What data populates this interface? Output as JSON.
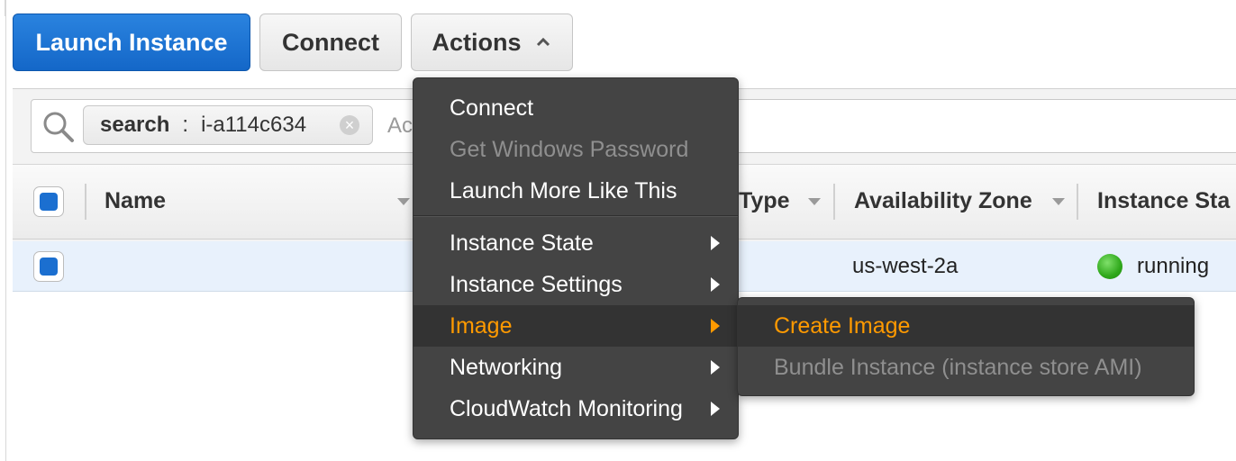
{
  "toolbar": {
    "launch_label": "Launch Instance",
    "connect_label": "Connect",
    "actions_label": "Actions"
  },
  "search": {
    "token_key": "search",
    "token_sep": ":",
    "token_value": "i-a114c634",
    "placeholder_fragment": "Ac"
  },
  "table": {
    "columns": [
      "Name",
      "Type",
      "Availability Zone",
      "Instance Sta"
    ],
    "row": {
      "name": "",
      "availability_zone": "us-west-2a",
      "instance_state": "running"
    }
  },
  "actions_menu": {
    "items": [
      {
        "label": "Connect",
        "enabled": true
      },
      {
        "label": "Get Windows Password",
        "enabled": false
      },
      {
        "label": "Launch More Like This",
        "enabled": true
      },
      {
        "label": "Instance State",
        "submenu": true
      },
      {
        "label": "Instance Settings",
        "submenu": true
      },
      {
        "label": "Image",
        "submenu": true,
        "active": true
      },
      {
        "label": "Networking",
        "submenu": true
      },
      {
        "label": "CloudWatch Monitoring",
        "submenu": true
      }
    ]
  },
  "image_submenu": {
    "items": [
      {
        "label": "Create Image",
        "active": true
      },
      {
        "label": "Bundle Instance (instance store AMI)",
        "enabled": false
      }
    ]
  },
  "colors": {
    "primary": "#1b6fd0",
    "menu_bg": "#444444",
    "highlight": "#ff9a00",
    "running": "#2fa81b"
  }
}
